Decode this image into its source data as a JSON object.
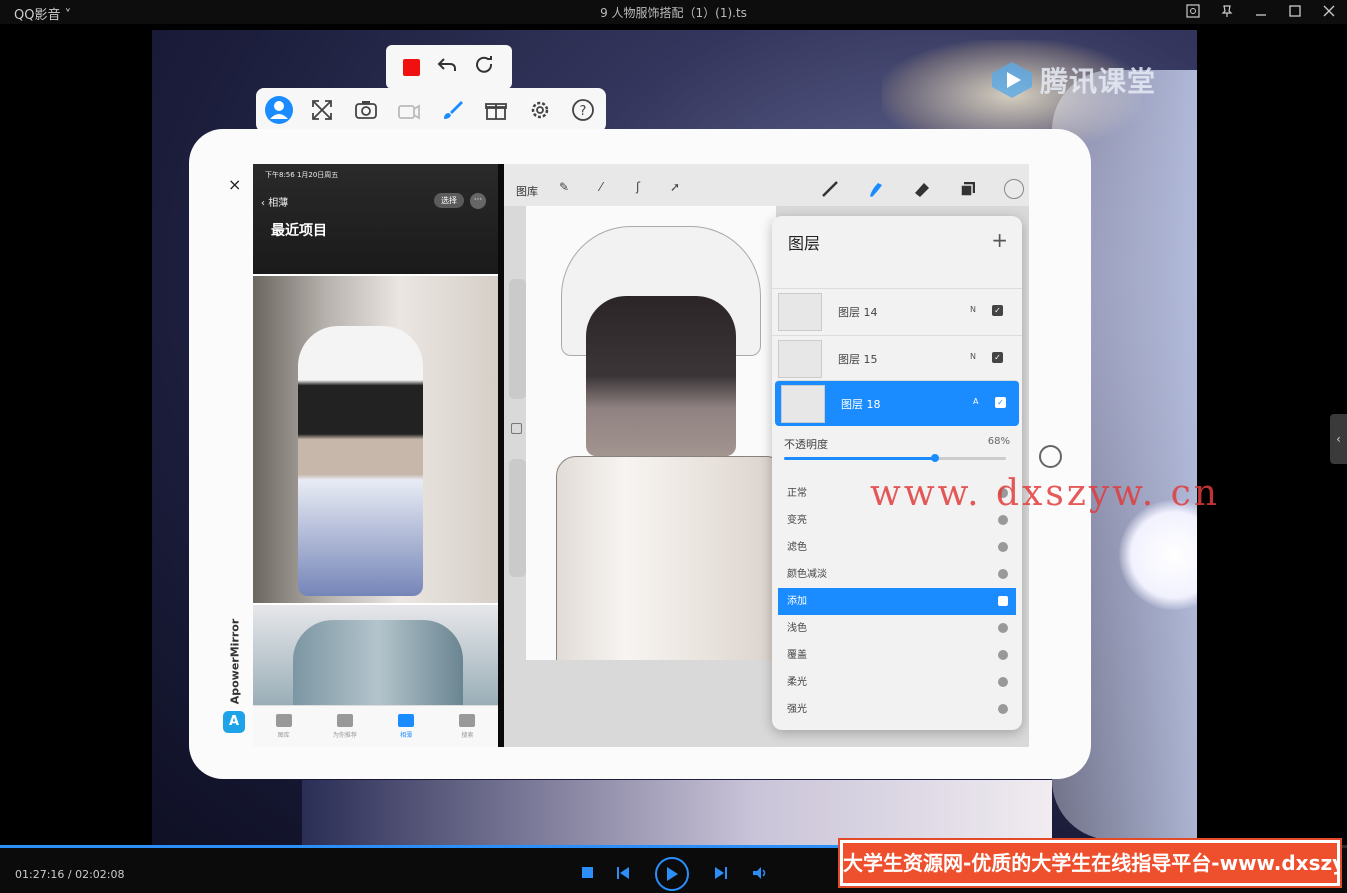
{
  "app": {
    "name": "QQ影音",
    "file_title": "9 人物服饰搭配（1）(1).ts"
  },
  "video": {
    "brand": "腾讯课堂",
    "watermark": "www. dxszyw. cn"
  },
  "mirror": {
    "brand": "ApowerMirror"
  },
  "photos_app": {
    "status": "下午8:56  1月20日周五",
    "back_label": "相薄",
    "select_label": "选择",
    "more_label": "···",
    "title": "最近项目",
    "tabs": [
      {
        "label": "图库"
      },
      {
        "label": "为你推荐"
      },
      {
        "label": "相薄"
      },
      {
        "label": "搜索"
      }
    ]
  },
  "procreate": {
    "gallery_label": "图库",
    "layers_title": "图层",
    "layers": [
      {
        "name": "图层 14",
        "mode": "N"
      },
      {
        "name": "图层 15",
        "mode": "N"
      },
      {
        "name": "图层 18",
        "mode": "A"
      }
    ],
    "opacity_label": "不透明度",
    "opacity_value": "68%",
    "opacity_fraction": 0.68,
    "blend_modes": [
      "正常",
      "变亮",
      "滤色",
      "颜色减淡",
      "添加",
      "浅色",
      "覆盖",
      "柔光",
      "强光"
    ],
    "active_blend_mode": "添加"
  },
  "player": {
    "time": "01:27:16 / 02:02:08",
    "progress_fraction": 0.717
  },
  "banner": {
    "text": "大学生资源网-优质的大学生在线指导平台-www.dxszyw.cn"
  },
  "colors": {
    "accent": "#2c8ef8",
    "procreate_blue": "#1a8cff",
    "record_red": "#f01010",
    "banner": "#ee4f2c"
  }
}
